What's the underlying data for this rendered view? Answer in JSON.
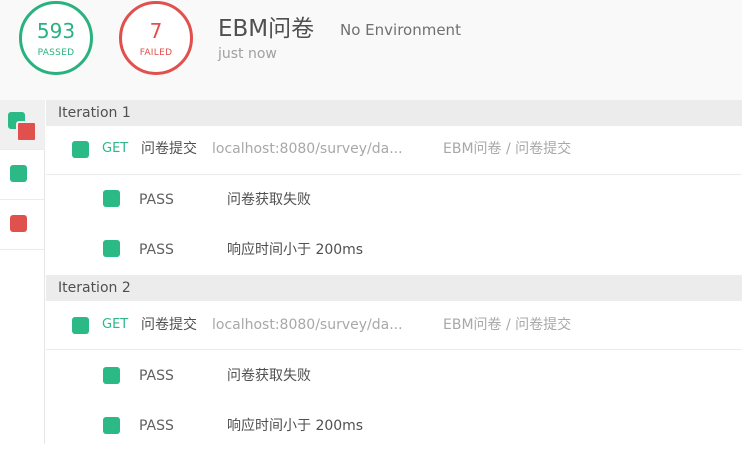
{
  "summary": {
    "passed_count": "593",
    "passed_label": "PASSED",
    "failed_count": "7",
    "failed_label": "FAILED",
    "title": "EBM问卷",
    "environment": "No Environment",
    "time": "just now"
  },
  "colors": {
    "pass": "#2bb985",
    "fail": "#e0504d"
  },
  "sidebar": [
    {
      "name": "all",
      "icon": "mixed-status-icon"
    },
    {
      "name": "passed",
      "icon": "green-square-icon"
    },
    {
      "name": "failed",
      "icon": "red-square-icon"
    }
  ],
  "iterations": [
    {
      "label": "Iteration 1",
      "request": {
        "method": "GET",
        "name": "问卷提交",
        "url": "localhost:8080/survey/da...",
        "collection": "EBM问卷 / 问卷提交"
      },
      "tests": [
        {
          "status": "PASS",
          "name": "问卷获取失败"
        },
        {
          "status": "PASS",
          "name": "响应时间小于 200ms"
        }
      ]
    },
    {
      "label": "Iteration 2",
      "request": {
        "method": "GET",
        "name": "问卷提交",
        "url": "localhost:8080/survey/da...",
        "collection": "EBM问卷 / 问卷提交"
      },
      "tests": [
        {
          "status": "PASS",
          "name": "问卷获取失败"
        },
        {
          "status": "PASS",
          "name": "响应时间小于 200ms"
        }
      ]
    }
  ]
}
